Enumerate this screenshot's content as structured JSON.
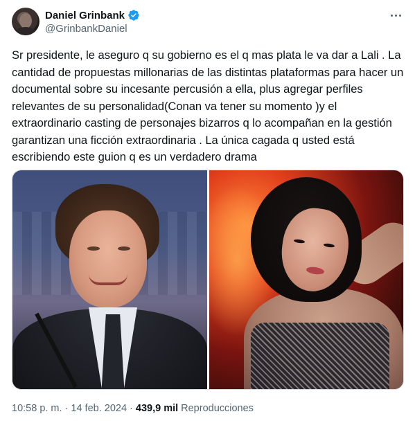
{
  "author": {
    "display_name": "Daniel Grinbank",
    "handle": "@GrinbankDaniel",
    "verified": true
  },
  "icons": {
    "verified": "verified-badge-icon",
    "more": "more-options-icon",
    "verified_color": "#1d9bf0"
  },
  "tweet": {
    "text": "Sr presidente, le aseguro q su gobierno es el q mas plata le va dar a Lali . La cantidad de propuestas millonarias de las distintas plataformas para hacer un documental sobre su incesante percusión a ella, plus agregar perfiles relevantes de su personalidad(Conan va tener su momento )y el extraordinario casting de personajes bizarros q lo acompañan en la gestión garantizan una ficción extraordinaria . La única cagada q usted está escribiendo este guion q es un verdadero drama"
  },
  "meta": {
    "time": "10:58 p. m.",
    "separator": "·",
    "date": "14 feb. 2024",
    "views_count": "439,9 mil",
    "views_label": "Reproducciones"
  }
}
